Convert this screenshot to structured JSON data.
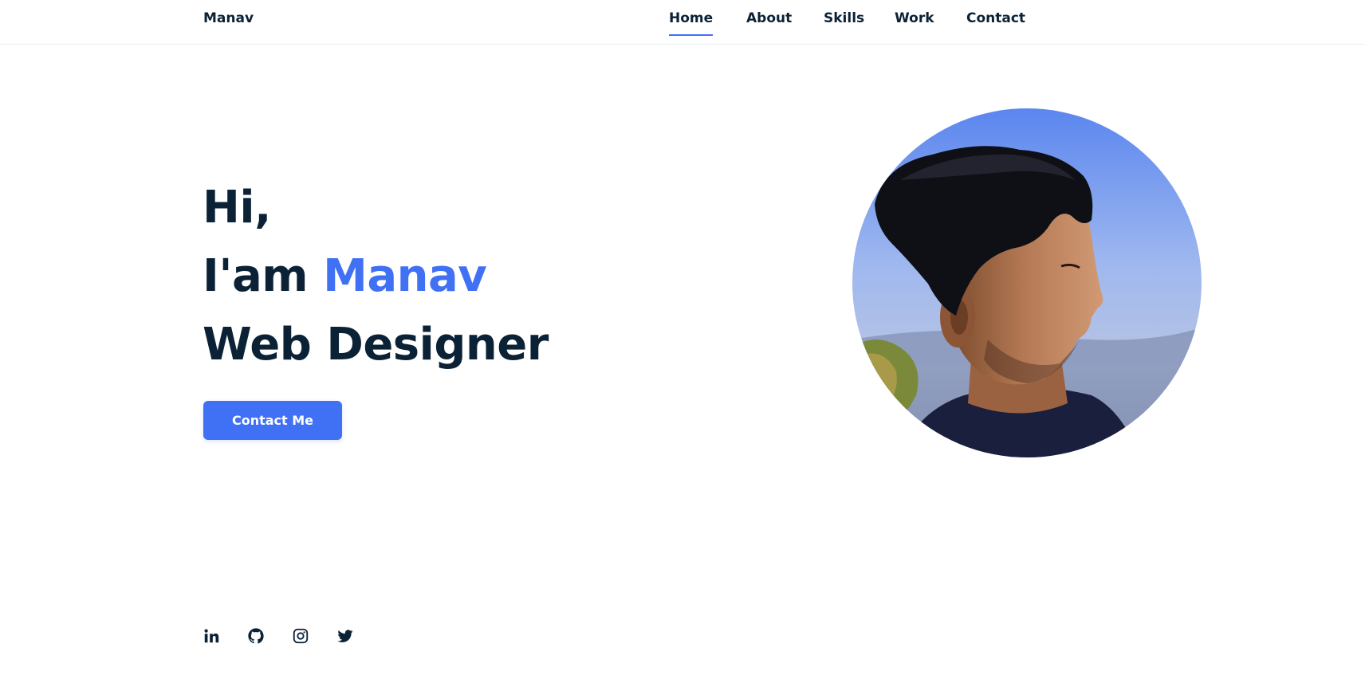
{
  "header": {
    "logo": "Manav",
    "nav": [
      {
        "label": "Home",
        "active": true
      },
      {
        "label": "About",
        "active": false
      },
      {
        "label": "Skills",
        "active": false
      },
      {
        "label": "Work",
        "active": false
      },
      {
        "label": "Contact",
        "active": false
      }
    ]
  },
  "hero": {
    "line1": "Hi,",
    "line2_prefix": "I'am ",
    "line2_name": "Manav",
    "line3": "Web Designer",
    "cta_label": "Contact Me"
  },
  "social": [
    {
      "icon": "linkedin-icon"
    },
    {
      "icon": "github-icon"
    },
    {
      "icon": "instagram-icon"
    },
    {
      "icon": "twitter-icon"
    }
  ],
  "colors": {
    "accent": "#4070f4",
    "text": "#0b2236",
    "background": "#ffffff"
  }
}
